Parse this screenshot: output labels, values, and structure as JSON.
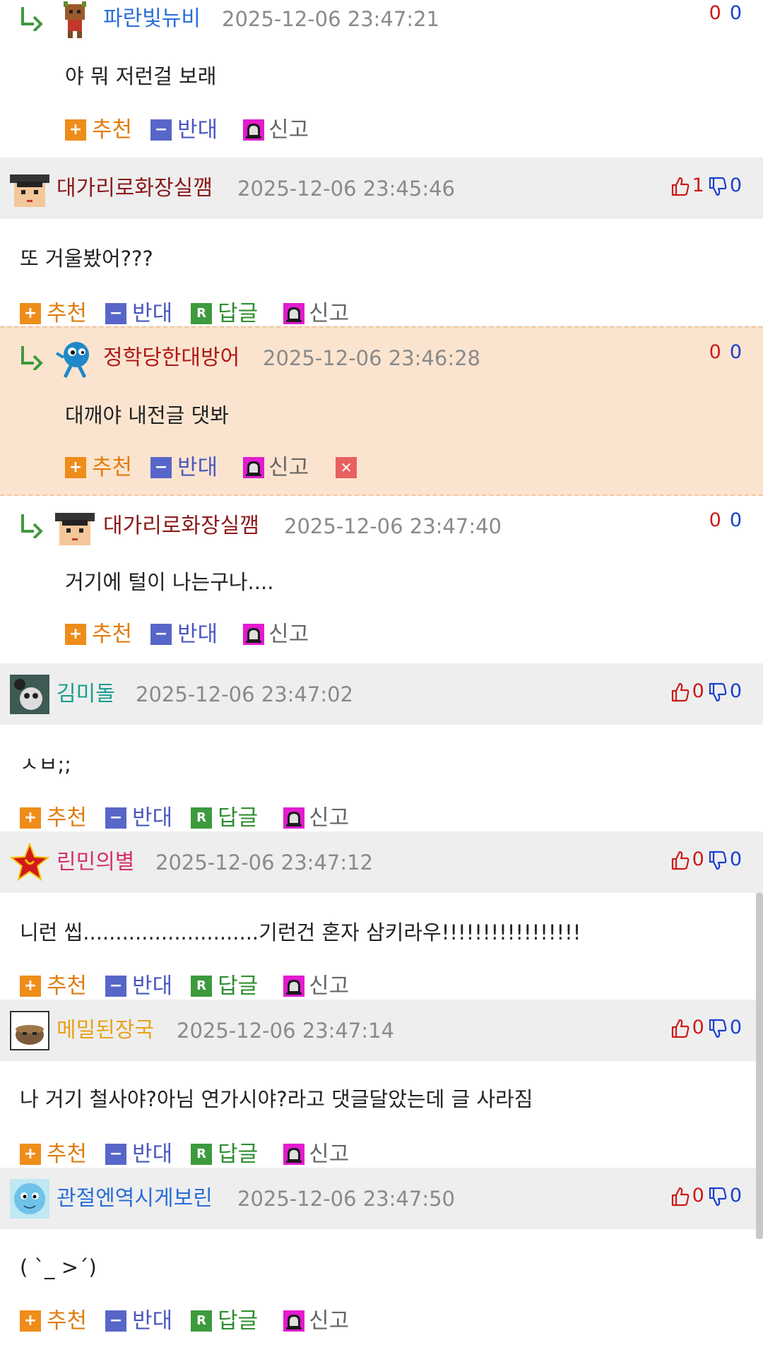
{
  "labels": {
    "recommend": "추천",
    "oppose": "반대",
    "reply": "답글",
    "report": "신고"
  },
  "colors": {
    "recommend": "#e07c0e",
    "oppose": "#4a58c0",
    "reply": "#2f8f2f",
    "up": "#cc1a1a",
    "down": "#1a3fcc",
    "highlight": "#fbe4cf"
  },
  "comments": [
    {
      "type": "reply",
      "nick": "파란빛뉴비",
      "nick_color": "#2a6ed8",
      "avatar": "groot-avatar",
      "date": "2025-12-06 23:47:21",
      "up": "0",
      "down": "0",
      "text": "야 뭐 저런걸 보래"
    },
    {
      "type": "root",
      "nick": "대가리로화장실깸",
      "nick_color": "#8b1a1a",
      "avatar": "graduate-avatar",
      "date": "2025-12-06 23:45:46",
      "up": "1",
      "down": "0",
      "text": "또 거울봤어???"
    },
    {
      "type": "reply",
      "nick": "정학당한대방어",
      "nick_color": "#b01818",
      "avatar": "blue-fish-avatar",
      "date": "2025-12-06 23:46:28",
      "up": "0",
      "down": "0",
      "text": "대깨야 내전글 댓봐",
      "selected": true
    },
    {
      "type": "reply",
      "nick": "대가리로화장실깸",
      "nick_color": "#8b1a1a",
      "avatar": "graduate-avatar",
      "date": "2025-12-06 23:47:40",
      "up": "0",
      "down": "0",
      "text": "거기에 털이 나는구나...."
    },
    {
      "type": "root",
      "nick": "김미돌",
      "nick_color": "#1a9e8f",
      "avatar": "creature-avatar",
      "date": "2025-12-06 23:47:02",
      "up": "0",
      "down": "0",
      "text": "ㅅㅂ;;"
    },
    {
      "type": "root",
      "nick": "린민의별",
      "nick_color": "#d4306a",
      "avatar": "red-star-avatar",
      "date": "2025-12-06 23:47:12",
      "up": "0",
      "down": "0",
      "text": "니런 씹...........................기런건 혼자 삼키라우!!!!!!!!!!!!!!!!!"
    },
    {
      "type": "root",
      "nick": "메밀된장국",
      "nick_color": "#e8a21a",
      "avatar": "bowl-avatar",
      "date": "2025-12-06 23:47:14",
      "up": "0",
      "down": "0",
      "text": "나 거기 철사야?아님 연가시야?라고 댓글달았는데 글 사라짐"
    },
    {
      "type": "root",
      "nick": "관절엔역시게보린",
      "nick_color": "#2a6ed8",
      "avatar": "squirtle-avatar",
      "date": "2025-12-06 23:47:50",
      "up": "0",
      "down": "0",
      "text": "( `_ >´)"
    }
  ]
}
